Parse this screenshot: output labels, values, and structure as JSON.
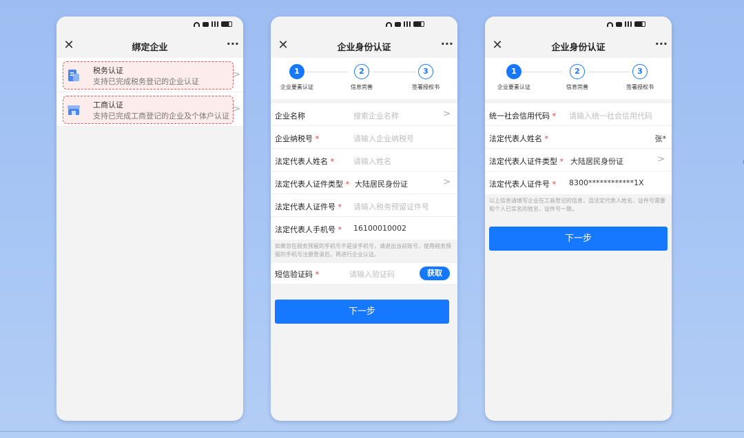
{
  "colors": {
    "accent": "#1677ff",
    "required": "#e53935",
    "highlight_border": "#e05a5a"
  },
  "status_icons": [
    "wifi-icon",
    "hd-icon",
    "signal-icon",
    "battery-icon"
  ],
  "nav_icons": {
    "close": "✕",
    "more": "···"
  },
  "phone1": {
    "title": "绑定企业",
    "items": [
      {
        "title": "税务认证",
        "subtitle": "支持已完成税务登记的企业认证",
        "icon": "tax-document-icon"
      },
      {
        "title": "工商认证",
        "subtitle": "支持已完成工商登记的企业及个体户认证",
        "icon": "business-store-icon"
      }
    ]
  },
  "phone2": {
    "title": "企业身份认证",
    "steps": [
      {
        "num": "1",
        "label": "企业要素认证",
        "state": "active"
      },
      {
        "num": "2",
        "label": "信息完善",
        "state": "pending"
      },
      {
        "num": "3",
        "label": "签署授权书",
        "state": "pending"
      }
    ],
    "fields": [
      {
        "label": "企业名称",
        "required": "",
        "value": "",
        "placeholder": "搜索企业名称",
        "chevron": ">"
      },
      {
        "label": "企业纳税号",
        "required": "*",
        "value": "",
        "placeholder": "请输入企业纳税号",
        "chevron": ""
      },
      {
        "label": "法定代表人姓名",
        "required": "*",
        "value": "",
        "placeholder": "请输入姓名",
        "chevron": ""
      },
      {
        "label": "法定代表人证件类型",
        "required": "*",
        "value": "大陆居民身份证",
        "placeholder": "",
        "chevron": ">"
      },
      {
        "label": "法定代表人证件号",
        "required": "*",
        "value": "",
        "placeholder": "请输入税务预留证件号",
        "chevron": ""
      },
      {
        "label": "法定代表人手机号",
        "required": "*",
        "value": "16100010002",
        "placeholder": "",
        "chevron": ""
      }
    ],
    "note": "如果您在税务预留的手机号不是该手机号，请退出当前账号，使用税务预留的手机号注册登录后，再进行企业认证。",
    "sms": {
      "label": "短信验证码",
      "required": "*",
      "placeholder": "请输入验证码",
      "button": "获取"
    },
    "next_button": "下一步"
  },
  "phone3": {
    "title": "企业身份认证",
    "steps": [
      {
        "num": "1",
        "label": "企业要素认证",
        "state": "active"
      },
      {
        "num": "2",
        "label": "信息完善",
        "state": "pending"
      },
      {
        "num": "3",
        "label": "签署授权书",
        "state": "pending"
      }
    ],
    "fields": [
      {
        "label": "统一社会信用代码",
        "required": "*",
        "value": "",
        "placeholder": "请输入统一社会信用代码",
        "chevron": ""
      },
      {
        "label": "法定代表人姓名",
        "required": "*",
        "value": "张*",
        "placeholder": "",
        "chevron": ""
      },
      {
        "label": "法定代表人证件类型",
        "required": "*",
        "value": "大陆居民身份证",
        "placeholder": "",
        "chevron": ">"
      },
      {
        "label": "法定代表人证件号",
        "required": "*",
        "value": "8300************1X",
        "placeholder": "",
        "chevron": ""
      }
    ],
    "note": "以上信息请填写企业在工商登记的信息，且法定代表人姓名、证件号需要和个人已实名的姓名、证件号一致。",
    "next_button": "下一步"
  }
}
